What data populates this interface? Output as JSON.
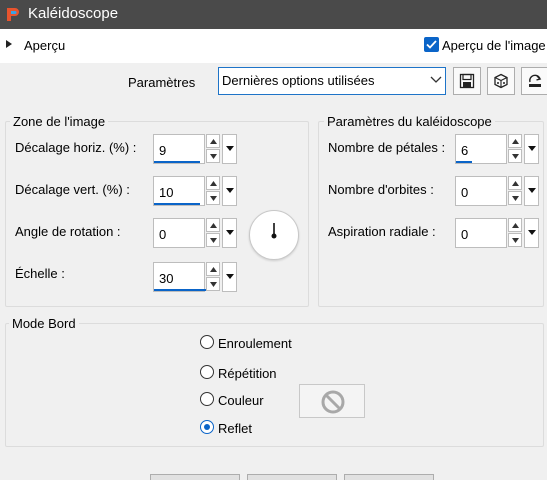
{
  "window": {
    "title": "Kaléidoscope",
    "app_icon": "paintshop-logo-icon"
  },
  "preview": {
    "section_label": "Aperçu",
    "checkbox_label": "Aperçu de l'image",
    "checked": true
  },
  "presets": {
    "label": "Paramètres",
    "selected": "Dernières options utilisées",
    "icons": [
      "save-icon",
      "reset-dice-icon",
      "load-preset-icon"
    ]
  },
  "image_zone": {
    "title": "Zone de l'image",
    "horiz_offset": {
      "label": "Décalage horiz. (%) :",
      "value": "9"
    },
    "vert_offset": {
      "label": "Décalage vert. (%) :",
      "value": "10"
    },
    "rotation": {
      "label": "Angle de rotation :",
      "value": "0"
    },
    "scale": {
      "label": "Échelle :",
      "value": "30"
    }
  },
  "kaleido": {
    "title": "Paramètres du kaléidoscope",
    "petals": {
      "label": "Nombre de pétales :",
      "value": "6"
    },
    "orbits": {
      "label": "Nombre d'orbites :",
      "value": "0"
    },
    "radial": {
      "label": "Aspiration radiale :",
      "value": "0"
    }
  },
  "edge_mode": {
    "title": "Mode Bord",
    "options": [
      "Enroulement",
      "Répétition",
      "Couleur",
      "Reflet"
    ],
    "selected": "Reflet"
  },
  "colors": {
    "accent": "#0a64c8",
    "titlebar": "#4a4a4a",
    "window_bg": "#f0f0f0"
  }
}
